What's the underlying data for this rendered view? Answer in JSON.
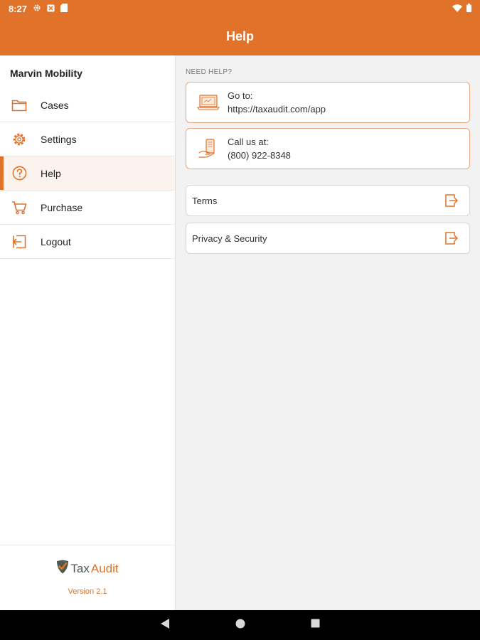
{
  "status_bar": {
    "time": "8:27",
    "left_icons": [
      "gear-icon",
      "notification-icon",
      "sd-card-icon"
    ],
    "right_icons": [
      "wifi-icon",
      "battery-icon"
    ]
  },
  "app_bar": {
    "title": "Help"
  },
  "sidebar": {
    "user_name": "Marvin Mobility",
    "items": [
      {
        "label": "Cases",
        "icon": "folder-icon",
        "active": false
      },
      {
        "label": "Settings",
        "icon": "gear-icon",
        "active": false
      },
      {
        "label": "Help",
        "icon": "help-circle-icon",
        "active": true
      },
      {
        "label": "Purchase",
        "icon": "cart-icon",
        "active": false
      },
      {
        "label": "Logout",
        "icon": "logout-icon",
        "active": false
      }
    ],
    "footer": {
      "brand_tax": "Tax",
      "brand_audit": "Audit",
      "version": "Version 2.1"
    }
  },
  "content": {
    "section_label": "NEED HELP?",
    "website": {
      "label": "Go to:",
      "value": "https://taxaudit.com/app",
      "icon": "laptop-icon"
    },
    "phone": {
      "label": "Call us at:",
      "value": "(800) 922-8348",
      "icon": "phone-hand-icon"
    },
    "links": [
      {
        "label": "Terms",
        "icon": "open-external-icon"
      },
      {
        "label": "Privacy & Security",
        "icon": "open-external-icon"
      }
    ]
  },
  "colors": {
    "accent": "#e07229",
    "accent_light": "#fcf3ee",
    "background": "#f2f2f2"
  },
  "system_nav": [
    "back-icon",
    "home-icon",
    "recents-icon"
  ]
}
